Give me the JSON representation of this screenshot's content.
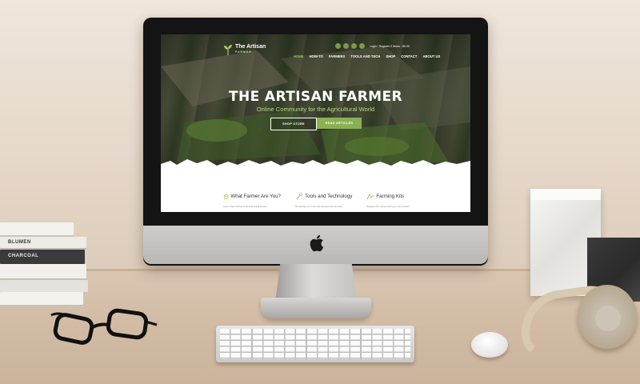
{
  "website": {
    "logo": {
      "name": "The Artisan",
      "sub": "FARMER"
    },
    "topbar": {
      "text": "Login / Register    0 items - $0.00"
    },
    "nav": [
      {
        "label": "HOME"
      },
      {
        "label": "HOW-TO"
      },
      {
        "label": "FARMERS"
      },
      {
        "label": "TOOLS AND TECH"
      },
      {
        "label": "SHOP"
      },
      {
        "label": "CONTACT"
      },
      {
        "label": "ABOUT US"
      }
    ],
    "hero": {
      "title": "THE ARTISAN FARMER",
      "subtitle": "Online Community for the Agricultural World",
      "shop_button": "SHOP STORE",
      "read_button": "READ ARTICLES"
    },
    "features": [
      {
        "title": "What Farmer Are You?",
        "desc": "Learn what method of farming would fit best",
        "icon": "farmer-icon"
      },
      {
        "title": "Tools and Technology",
        "desc": "Reviewing new tools and services that can help",
        "icon": "tools-icon"
      },
      {
        "title": "Farming Kits",
        "desc": "Replace this content with your own content",
        "icon": "kit-icon"
      }
    ],
    "colors": {
      "accent": "#8bb053",
      "accent_light": "#b9d68a"
    }
  },
  "books": {
    "spines": [
      "BLUMEN",
      "CHARCOAL"
    ]
  }
}
